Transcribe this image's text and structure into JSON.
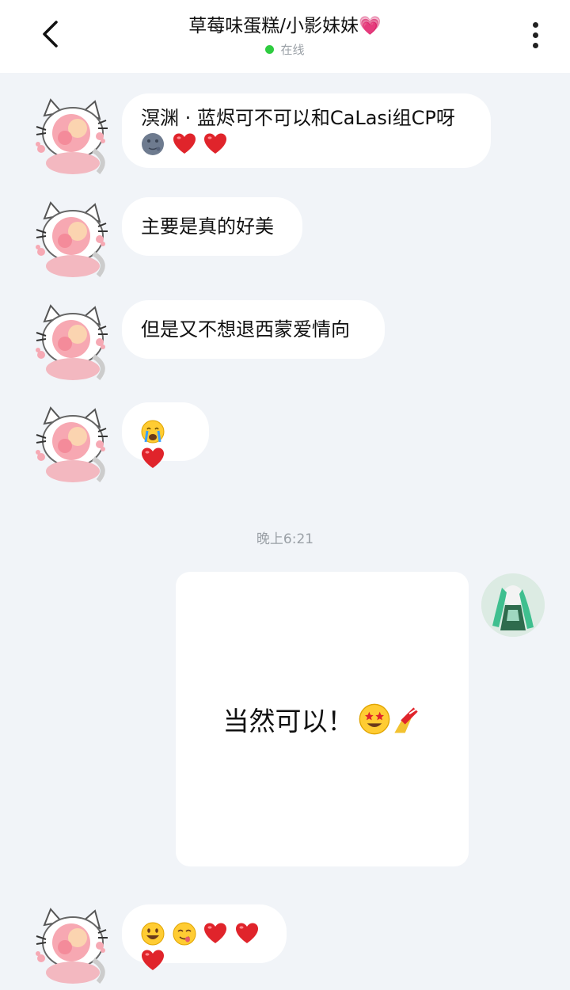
{
  "header": {
    "title": "草莓味蛋糕/小影妹妹💗",
    "status": "在线"
  },
  "messages": [
    {
      "line1": "溟渊 · 蓝烬可不可以和CaLasi组CP呀",
      "emojis": [
        "moon-face",
        "red-heart",
        "red-heart"
      ]
    },
    {
      "text": "主要是真的好美"
    },
    {
      "text": "但是又不想退西蒙爱情向"
    },
    {
      "emojis": [
        "crying-face",
        "red-heart"
      ]
    },
    {
      "emojis": [
        "grinning-face",
        "yum-face",
        "red-heart",
        "red-heart",
        "red-heart"
      ]
    }
  ],
  "timestamp": "晚上6:21",
  "sent_card": {
    "text": "当然可以！",
    "emojis": [
      "star-struck-face",
      "nail-polish"
    ]
  },
  "colors": {
    "background": "#f1f4f8",
    "bubble": "#ffffff",
    "online": "#2ecc40",
    "heart": "#e0242b"
  }
}
